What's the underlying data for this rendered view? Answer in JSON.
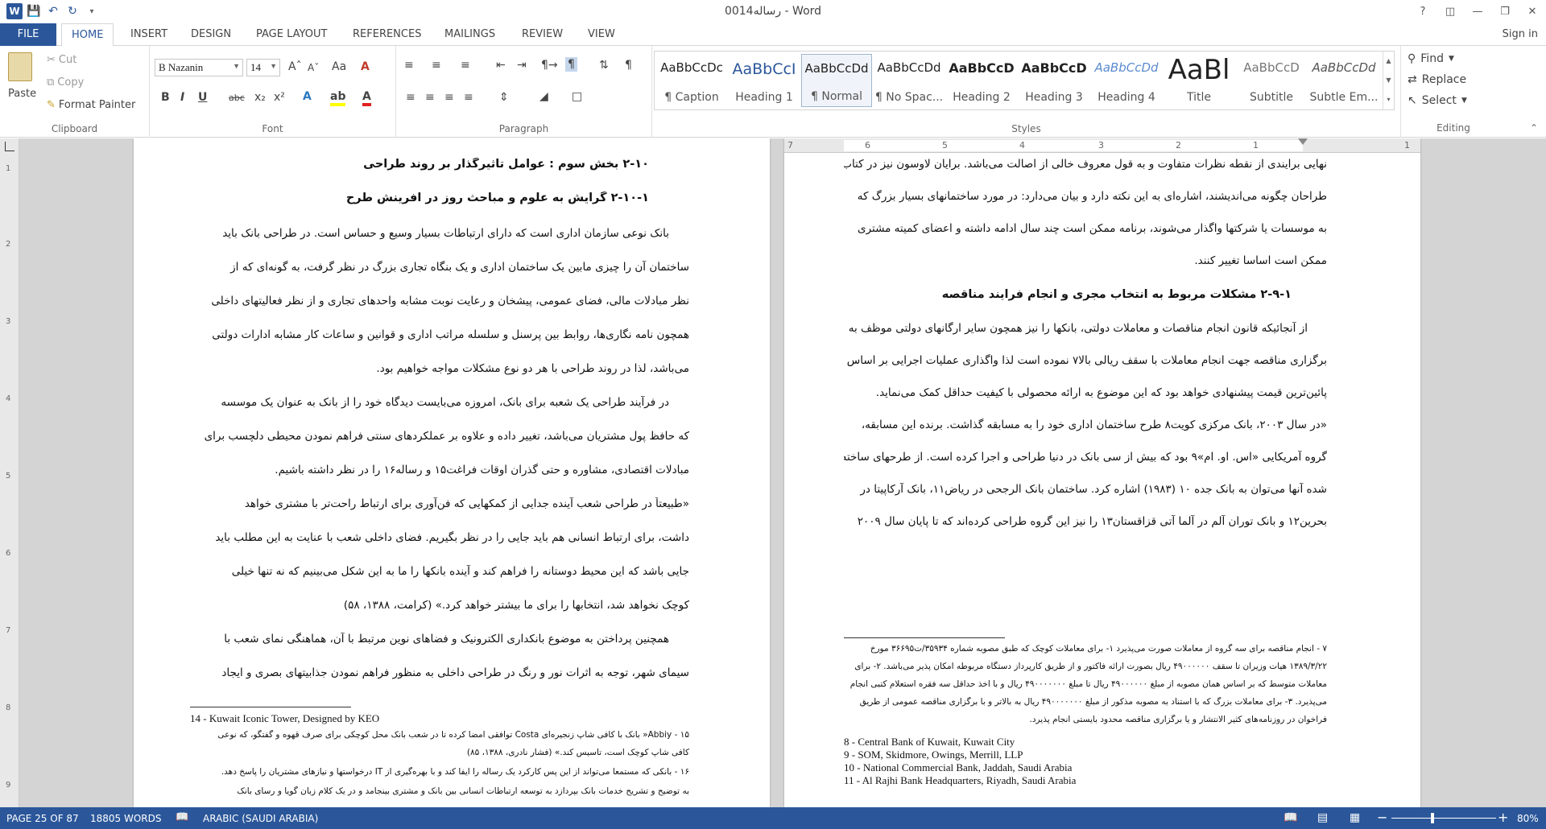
{
  "window": {
    "title": "رساله0014 - Word",
    "help": "?",
    "minimize": "—",
    "restore": "❐",
    "close": "✕"
  },
  "quick_access": {
    "logo": "W"
  },
  "tabs": [
    "FILE",
    "HOME",
    "INSERT",
    "DESIGN",
    "PAGE LAYOUT",
    "REFERENCES",
    "MAILINGS",
    "REVIEW",
    "VIEW"
  ],
  "signin": "Sign in",
  "clipboard": {
    "paste": "Paste",
    "cut": "Cut",
    "copy": "Copy",
    "format_painter": "Format Painter",
    "label": "Clipboard"
  },
  "font": {
    "name": "B Nazanin",
    "size": "14",
    "label": "Font"
  },
  "paragraph": {
    "label": "Paragraph"
  },
  "styles": {
    "label": "Styles",
    "items": [
      {
        "preview": "AaBbCcDc",
        "name": "¶ Caption"
      },
      {
        "preview": "AaBbCcI",
        "name": "Heading 1"
      },
      {
        "preview": "AaBbCcDd",
        "name": "¶ Normal"
      },
      {
        "preview": "AaBbCcDd",
        "name": "¶ No Spac..."
      },
      {
        "preview": "AaBbCcD",
        "name": "Heading 2"
      },
      {
        "preview": "AaBbCcD",
        "name": "Heading 3"
      },
      {
        "preview": "AaBbCcDd",
        "name": "Heading 4"
      },
      {
        "preview": "AaBl",
        "name": "Title"
      },
      {
        "preview": "AaBbCcD",
        "name": "Subtitle"
      },
      {
        "preview": "AaBbCcDd",
        "name": "Subtle Em..."
      }
    ]
  },
  "editing": {
    "find": "Find",
    "replace": "Replace",
    "select": "Select",
    "label": "Editing"
  },
  "ruler": {
    "numbers": [
      "7",
      "6",
      "5",
      "4",
      "3",
      "2",
      "1",
      "1"
    ]
  },
  "vruler": {
    "numbers": [
      "1",
      "2",
      "3",
      "4",
      "5",
      "6",
      "7",
      "8",
      "9"
    ]
  },
  "left_page": {
    "lines": [
      {
        "text": "۲-۱۰ بخش سوم : عوامل تاثیرگذار بر روند طراحی",
        "heading": true
      },
      {
        "text": "۲-۱۰-۱ گرایش به علوم و مباحث روز در آفرینش طرح",
        "heading": true
      },
      {
        "text": "بانک نوعی سازمان اداری است که دارای ارتباطات بسیار وسیع و حساس است. در طراحی بانک باید"
      },
      {
        "text": "ساختمان آن را چیزی مابین یک ساختمان اداری و یک بنگاه تجاری بزرگ در نظر گرفت، به گونه‌ای که از"
      },
      {
        "text": "نظر مبادلات مالی، فضای عمومی، پیشخان و رعایت نوبت مشابه واحدهای تجاری و از نظر فعالیتهای داخلی"
      },
      {
        "text": "همچون نامه نگاری‌ها، روابط بین پرسنل و سلسله مراتب اداری و قوانین و ساعات کار مشابه ادارات دولتی"
      },
      {
        "text": "می‌باشد، لذا در روند طراحی با هر دو نوع مشکلات مواجه خواهیم بود."
      },
      {
        "text": "در فرآیند طراحی یک شعبه برای بانک، امروزه می‌بایست دیدگاه خود را از بانک به عنوان یک موسسه"
      },
      {
        "text": "که حافظ پول مشتریان می‌باشد، تغییر داده و علاوه بر عملکردهای سنتی فراهم نمودن محیطی دلچسب برای"
      },
      {
        "text": "مبادلات اقتصادی، مشاوره و حتی گذران اوقات فراغت۱۵ و رساله۱۶ را در نظر داشته باشیم."
      },
      {
        "text": "«طبیعتاً در طراحی شعب آینده جدایی از کمکهایی که فن‌آوری برای ارتباط راحت‌تر با مشتری خواهد"
      },
      {
        "text": "داشت، برای ارتباط انسانی هم باید جایی را در نظر بگیریم. فضای داخلی شعب با عنایت به این مطلب باید"
      },
      {
        "text": "جایی باشد که این محیط دوستانه را فراهم کند و آینده بانکها را ما به این شکل می‌بینیم که نه تنها خیلی"
      },
      {
        "text": "کوچک نخواهد شد، انتخابها را برای ما بیشتر خواهد کرد.» (کرامت، ۱۳۸۸، ۵۸)"
      },
      {
        "text": "همچنین پرداختن به موضوع بانکداری الکترونیک و فضاهای نوین مرتبط با آن، هماهنگی نمای شعب با"
      },
      {
        "text": "سیمای شهر، توجه به اثرات نور و رنگ در طراحی داخلی به منظور فراهم نمودن جذابیتهای بصری و ایجاد"
      }
    ],
    "footnotes": [
      {
        "text": "14 - Kuwait Iconic Tower, Designed by KEO",
        "ltr": true
      },
      {
        "text": "۱۵ - Abbiy« بانک با کافی شاپ زنجیره‌ای Costa توافقی امضا کرده تا در شعب بانک محل کوچکی برای صرف قهوه و گفتگو، که نوعی"
      },
      {
        "text": "کافی شاپ کوچک است، تاسیس کند.» (فشار نادری، ۱۳۸۸، ۸۵)"
      },
      {
        "text": "۱۶ - بانکی که مستمعا می‌تواند از این پس کارکرد یک رساله را ایفا کند و با بهره‌گیری از IT درخواستها و نیازهای مشتریان را پاسخ دهد."
      },
      {
        "text": "به توضیح و تشریح خدمات بانک بپردازد به توسعه ارتباطات انسانی بین بانک و مشتری بینجامد و در یک کلام زبان گویا و رسای بانک"
      }
    ]
  },
  "right_page": {
    "lines": [
      {
        "text": "نهایی برایندی از نقطه نظرات متفاوت و به قول معروف خالی از اصالت می‌باشد. برایان لاوسون نیز در کتاب"
      },
      {
        "text": "طراحان چگونه می‌اندیشند، اشاره‌ای به این نکته دارد و بیان می‌دارد: در مورد ساختمانهای بسیار بزرگ که"
      },
      {
        "text": "به موسسات یا شرکتها واگذار می‌شوند، برنامه ممکن است چند سال ادامه داشته و اعضای کمیته مشتری"
      },
      {
        "text": "ممکن است اساسا تغییر کنند."
      },
      {
        "text": "۲-۹-۱ مشکلات مربوط به انتخاب مجری و انجام فرآیند مناقصه",
        "heading": true
      },
      {
        "text": "از آنجائیکه قانون انجام مناقصات و معاملات دولتی، بانکها را نیز همچون سایر ارگانهای دولتی موظف به"
      },
      {
        "text": "برگزاری مناقصه جهت انجام معاملات با سقف ریالی بالا۷ نموده است لذا واگذاری عملیات اجرایی بر اساس"
      },
      {
        "text": "پائین‌ترین قیمت پیشنهادی خواهد بود که این موضوع به ارائه محصولی با کیفیت حداقل کمک می‌نماید."
      },
      {
        "text": "«در سال ۲۰۰۳، بانک مرکزی کویت۸ طرح ساختمان اداری خود را به مسابقه گذاشت. برنده این مسابقه،"
      },
      {
        "text": "گروه آمریکایی «اس. او. ام»۹ بود که بیش از سی بانک در دنیا طراحی و اجرا کرده است. از طرحهای ساخته"
      },
      {
        "text": "شده آنها می‌توان به بانک جده ۱۰ (۱۹۸۳) اشاره کرد. ساختمان بانک الرجحی در ریاض۱۱، بانک آرکاپیتا در"
      },
      {
        "text": "بحرین۱۲ و بانک توران آلم در آلما آتی قزاقستان۱۳ را نیز این گروه طراحی کرده‌اند که تا پایان سال ۲۰۰۹"
      }
    ],
    "footnotes": [
      {
        "text": "۷ - انجام مناقصه برای سه گروه از معاملات صورت می‌پذیرد ۱- برای معاملات کوچک که طبق مصوبه شماره ۳۵۹۳۴/ت۳۶۶۹۵ مورخ"
      },
      {
        "text": "۱۳۸۹/۳/۲۲ هیات وزیران تا سقف ۴۹۰۰۰۰۰۰ ریال بصورت ارائه فاکتور و از طریق کارپرداز دستگاه مربوطه امکان پذیر می‌باشد. ۲- برای"
      },
      {
        "text": "معاملات متوسط که بر اساس همان مصوبه از مبلغ ۴۹۰۰۰۰۰۰ ریال تا مبلغ ۴۹۰۰۰۰۰۰۰ ریال و با اخذ حداقل سه فقره استعلام کتبی انجام"
      },
      {
        "text": "می‌پذیرد. ۳- برای معاملات بزرگ که با استناد به مصوبه مذکور از مبلغ ۴۹۰۰۰۰۰۰۰ ریال به بالاتر و با برگزاری مناقصه عمومی از طریق"
      },
      {
        "text": "فراخوان در روزنامه‌های کثیر الانتشار و یا برگزاری مناقصه محدود بایستی انجام پذیرد."
      },
      {
        "text": "8 - Central Bank of Kuwait, Kuwait City",
        "ltr": true
      },
      {
        "text": "9 - SOM, Skidmore, Owings, Merrill, LLP",
        "ltr": true
      },
      {
        "text": "10 - National Commercial Bank, Jaddah, Saudi Arabia",
        "ltr": true
      },
      {
        "text": "11 - Al Rajhi Bank Headquarters, Riyadh, Saudi Arabia",
        "ltr": true
      }
    ]
  },
  "status": {
    "page": "PAGE 25 OF 87",
    "words": "18805 WORDS",
    "language": "ARABIC (SAUDI ARABIA)",
    "zoom": "80%",
    "zoom_level": 0.8
  }
}
